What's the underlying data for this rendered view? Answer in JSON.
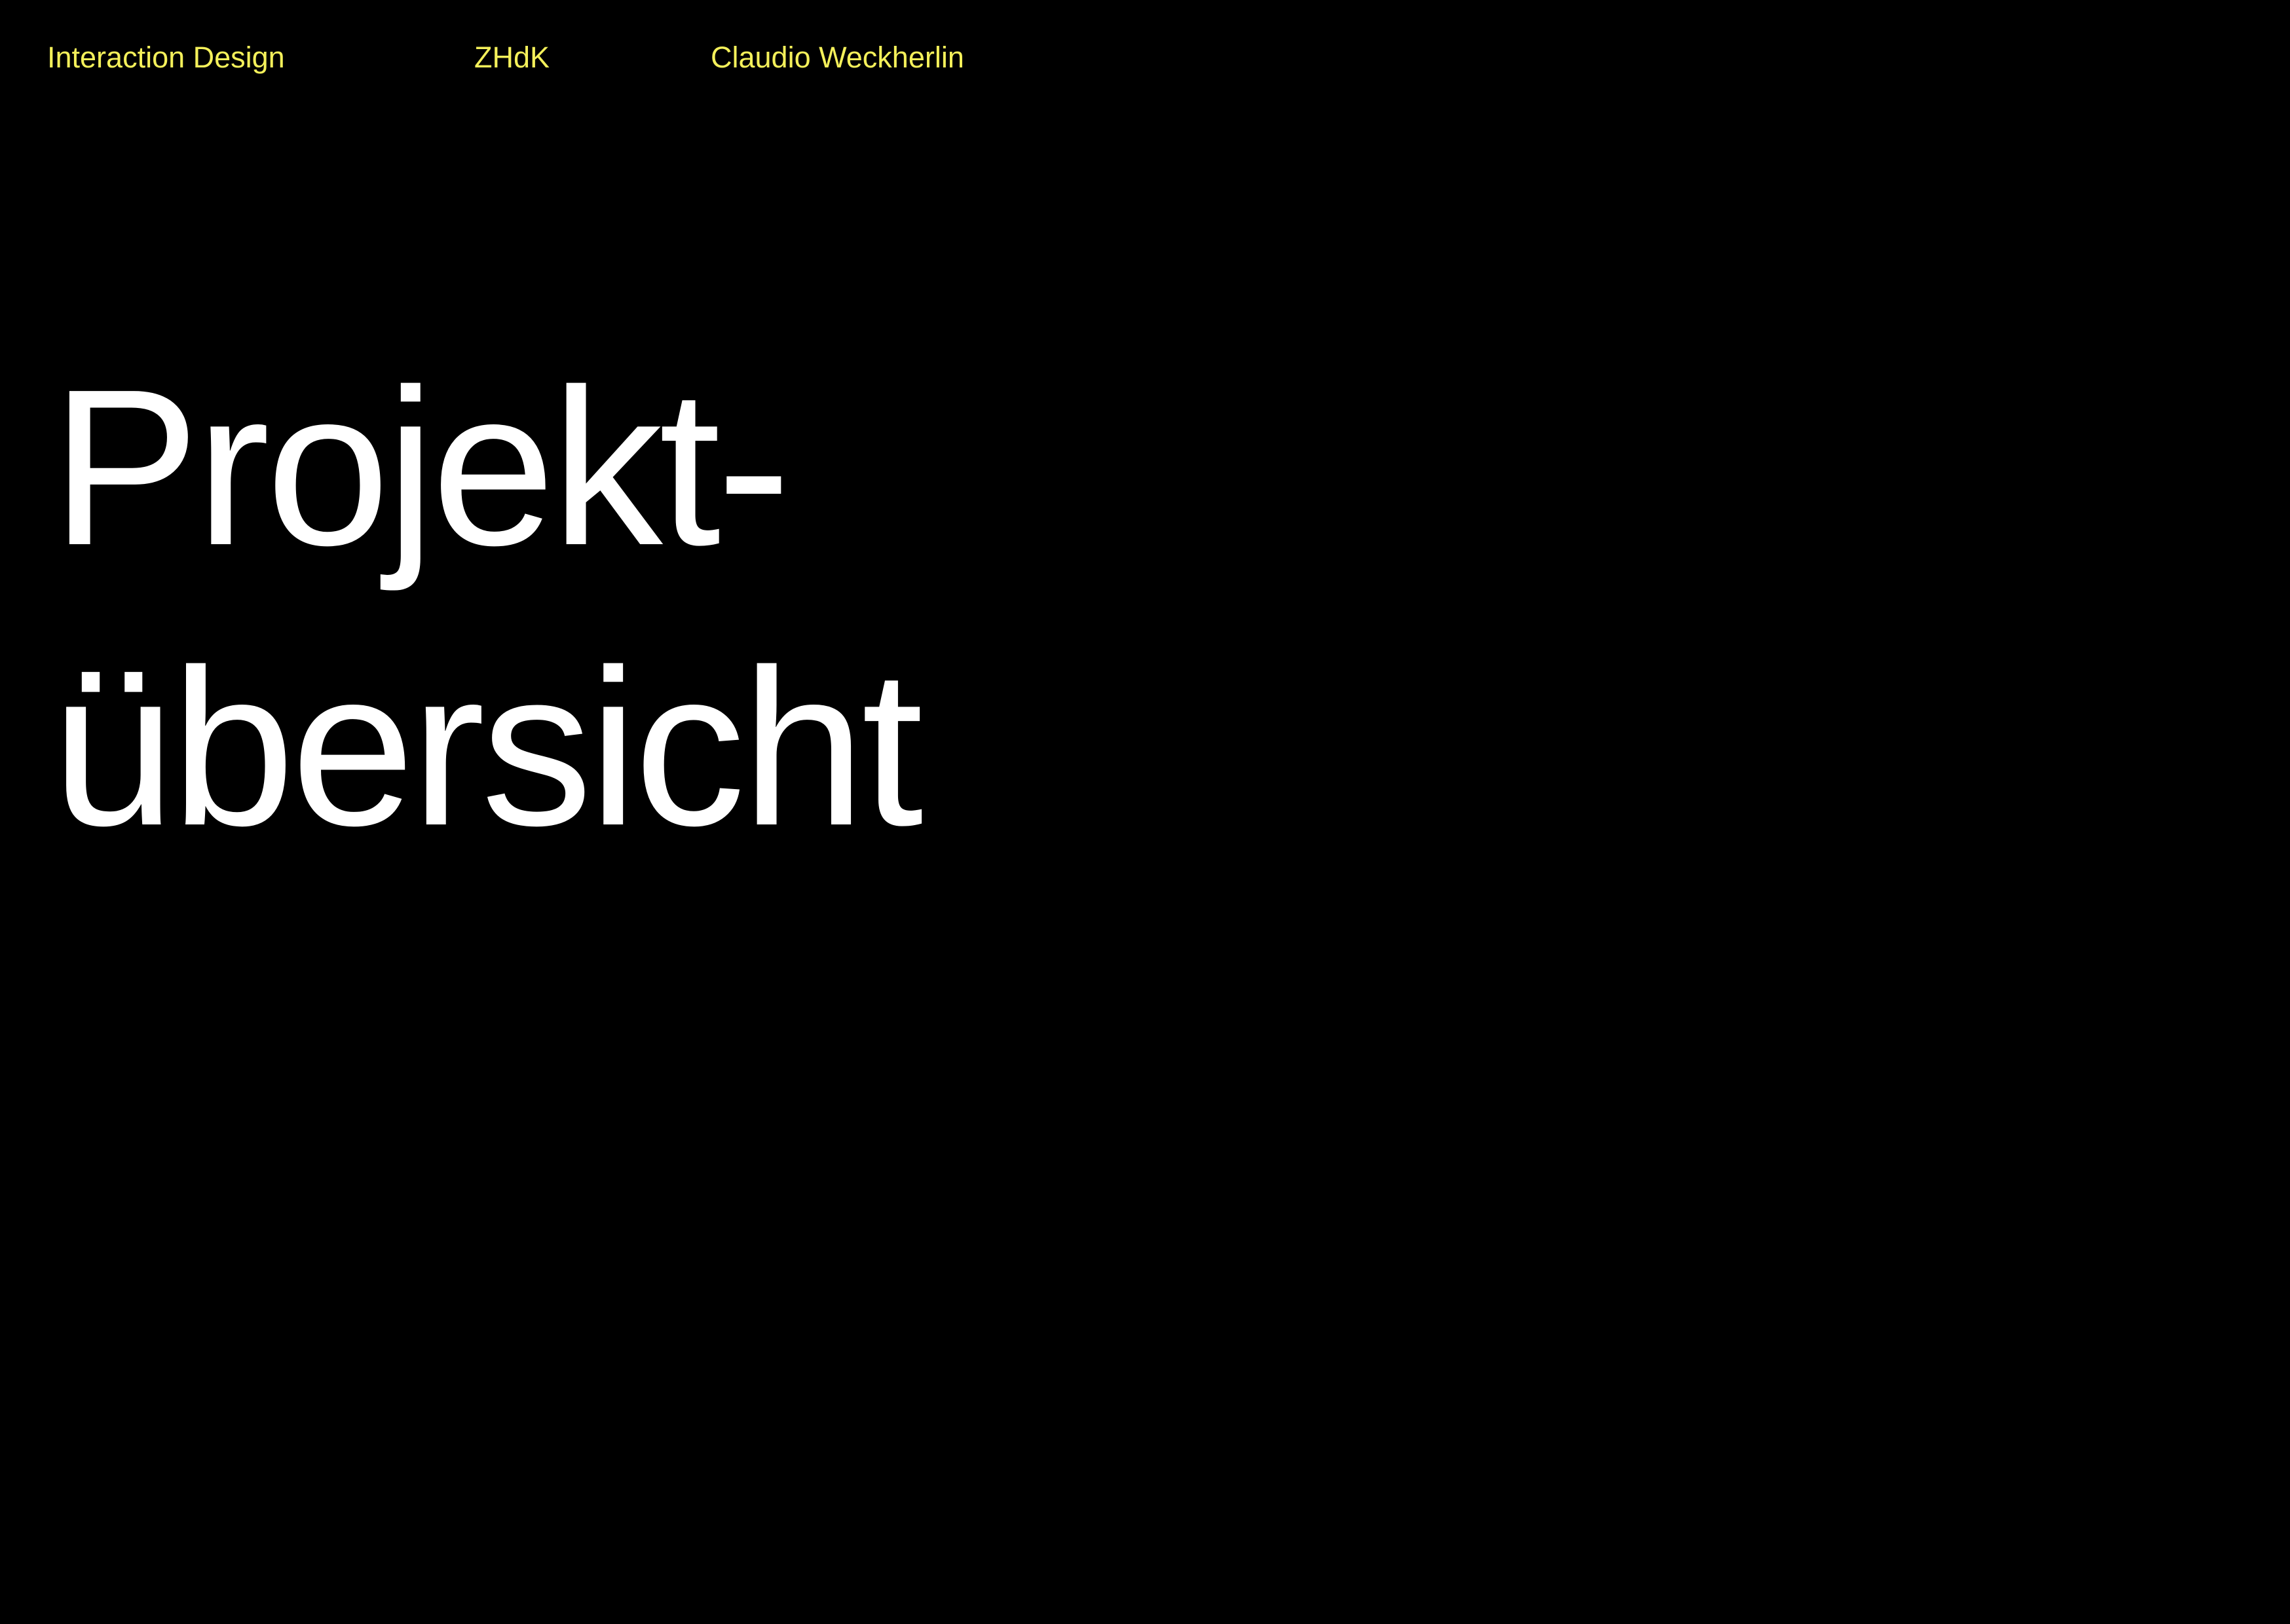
{
  "header": {
    "items": [
      "Interaction Design",
      "ZHdK",
      "Claudio Weckherlin"
    ],
    "color": "#f4f05a"
  },
  "title": {
    "line1": "Projekt-",
    "line2": "übersicht",
    "color": "#ffffff"
  },
  "background": "#000000"
}
